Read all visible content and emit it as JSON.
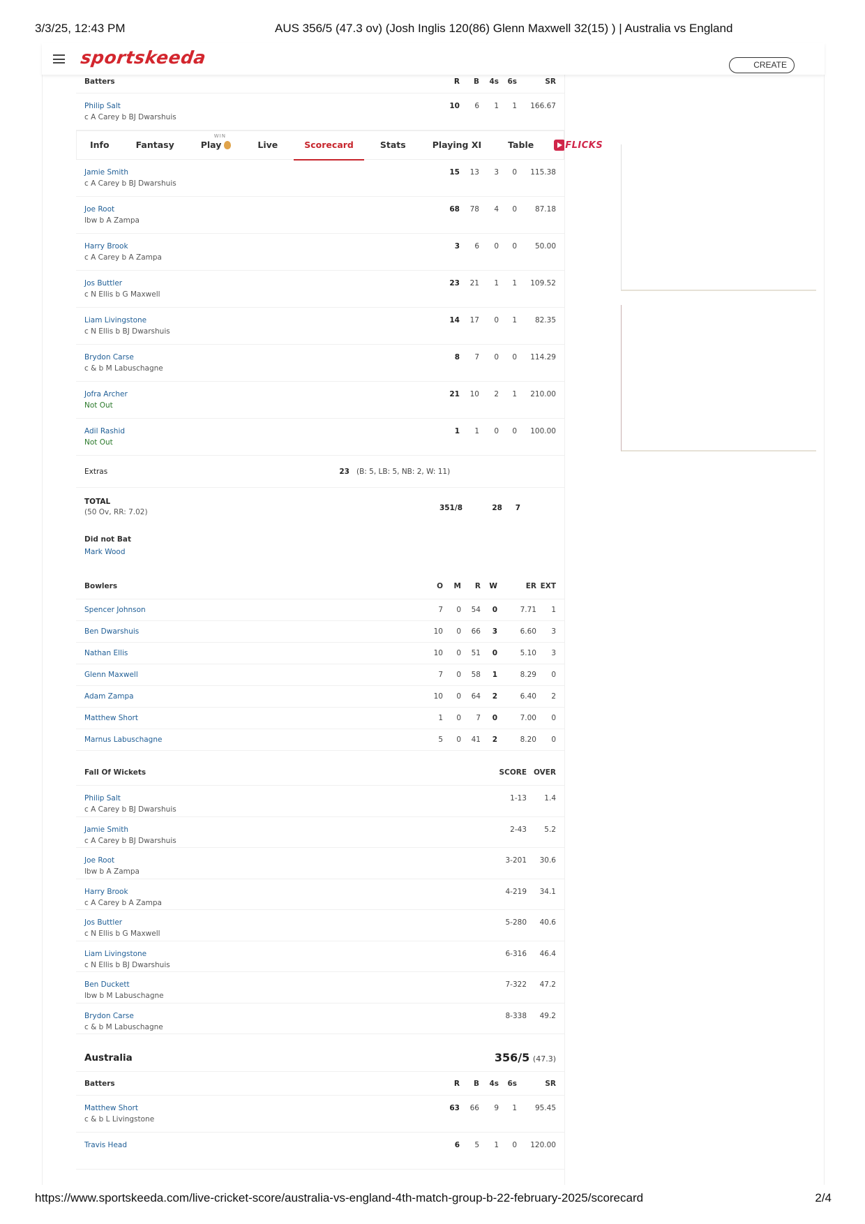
{
  "print_header": {
    "date": "3/3/25, 12:43 PM",
    "title": "AUS 356/5 (47.3 ov) (Josh Inglis 120(86) Glenn Maxwell 32(15) ) | Australia vs England"
  },
  "print_footer": {
    "url": "https://www.sportskeeda.com/live-cricket-score/australia-vs-england-4th-match-group-b-22-february-2025/scorecard",
    "page": "2/4"
  },
  "topbar": {
    "logo": "sportskeeda",
    "create_label": "CREATE",
    "brand_color": "#d3262e"
  },
  "tabs": {
    "items": [
      {
        "label": "Info"
      },
      {
        "label": "Fantasy"
      },
      {
        "label": "Play",
        "badge": "WIN"
      },
      {
        "label": "Live"
      },
      {
        "label": "Scorecard",
        "active": true
      },
      {
        "label": "Stats"
      },
      {
        "label": "Playing XI"
      },
      {
        "label": "Table"
      }
    ],
    "flicks_label": "FLICKS"
  },
  "england_innings": {
    "batting_header": {
      "title": "Batters",
      "r": "R",
      "b": "B",
      "fours": "4s",
      "sixes": "6s",
      "sr": "SR"
    },
    "batters": [
      {
        "name": "Philip Salt",
        "dismissal": "c A Carey b BJ Dwarshuis",
        "r": "10",
        "b": "6",
        "fours": "1",
        "sixes": "1",
        "sr": "166.67"
      },
      {
        "name": "Jamie Smith",
        "dismissal": "c A Carey b BJ Dwarshuis",
        "r": "15",
        "b": "13",
        "fours": "3",
        "sixes": "0",
        "sr": "115.38"
      },
      {
        "name": "Joe Root",
        "dismissal": "lbw b A Zampa",
        "r": "68",
        "b": "78",
        "fours": "4",
        "sixes": "0",
        "sr": "87.18"
      },
      {
        "name": "Harry Brook",
        "dismissal": "c A Carey b A Zampa",
        "r": "3",
        "b": "6",
        "fours": "0",
        "sixes": "0",
        "sr": "50.00"
      },
      {
        "name": "Jos Buttler",
        "dismissal": "c N Ellis b G Maxwell",
        "r": "23",
        "b": "21",
        "fours": "1",
        "sixes": "1",
        "sr": "109.52"
      },
      {
        "name": "Liam Livingstone",
        "dismissal": "c N Ellis b BJ Dwarshuis",
        "r": "14",
        "b": "17",
        "fours": "0",
        "sixes": "1",
        "sr": "82.35"
      },
      {
        "name": "Brydon Carse",
        "dismissal": "c & b M Labuschagne",
        "r": "8",
        "b": "7",
        "fours": "0",
        "sixes": "0",
        "sr": "114.29"
      },
      {
        "name": "Jofra Archer",
        "dismissal": "Not Out",
        "not_out": true,
        "r": "21",
        "b": "10",
        "fours": "2",
        "sixes": "1",
        "sr": "210.00"
      },
      {
        "name": "Adil Rashid",
        "dismissal": "Not Out",
        "not_out": true,
        "r": "1",
        "b": "1",
        "fours": "0",
        "sixes": "0",
        "sr": "100.00"
      }
    ],
    "extras": {
      "label": "Extras",
      "value": "23",
      "detail": "(B: 5, LB: 5, NB: 2, W: 11)"
    },
    "total": {
      "label": "TOTAL",
      "detail": "(50 Ov, RR: 7.02)",
      "score": "351/8",
      "fours": "28",
      "sixes": "7"
    },
    "did_not_bat": {
      "label": "Did not Bat",
      "players": [
        "Mark Wood"
      ]
    },
    "bowling_header": {
      "title": "Bowlers",
      "o": "O",
      "m": "M",
      "r": "R",
      "w": "W",
      "er": "ER",
      "ext": "EXT"
    },
    "bowlers": [
      {
        "name": "Spencer Johnson",
        "o": "7",
        "m": "0",
        "r": "54",
        "w": "0",
        "er": "7.71",
        "ext": "1"
      },
      {
        "name": "Ben Dwarshuis",
        "o": "10",
        "m": "0",
        "r": "66",
        "w": "3",
        "er": "6.60",
        "ext": "3"
      },
      {
        "name": "Nathan Ellis",
        "o": "10",
        "m": "0",
        "r": "51",
        "w": "0",
        "er": "5.10",
        "ext": "3"
      },
      {
        "name": "Glenn Maxwell",
        "o": "7",
        "m": "0",
        "r": "58",
        "w": "1",
        "er": "8.29",
        "ext": "0"
      },
      {
        "name": "Adam Zampa",
        "o": "10",
        "m": "0",
        "r": "64",
        "w": "2",
        "er": "6.40",
        "ext": "2"
      },
      {
        "name": "Matthew Short",
        "o": "1",
        "m": "0",
        "r": "7",
        "w": "0",
        "er": "7.00",
        "ext": "0"
      },
      {
        "name": "Marnus Labuschagne",
        "o": "5",
        "m": "0",
        "r": "41",
        "w": "2",
        "er": "8.20",
        "ext": "0"
      }
    ],
    "fow_header": {
      "title": "Fall Of Wickets",
      "score": "SCORE",
      "over": "OVER"
    },
    "fall_of_wickets": [
      {
        "name": "Philip Salt",
        "dismissal": "c A Carey b BJ Dwarshuis",
        "score": "1-13",
        "over": "1.4"
      },
      {
        "name": "Jamie Smith",
        "dismissal": "c A Carey b BJ Dwarshuis",
        "score": "2-43",
        "over": "5.2"
      },
      {
        "name": "Joe Root",
        "dismissal": "lbw b A Zampa",
        "score": "3-201",
        "over": "30.6"
      },
      {
        "name": "Harry Brook",
        "dismissal": "c A Carey b A Zampa",
        "score": "4-219",
        "over": "34.1"
      },
      {
        "name": "Jos Buttler",
        "dismissal": "c N Ellis b G Maxwell",
        "score": "5-280",
        "over": "40.6"
      },
      {
        "name": "Liam Livingstone",
        "dismissal": "c N Ellis b BJ Dwarshuis",
        "score": "6-316",
        "over": "46.4"
      },
      {
        "name": "Ben Duckett",
        "dismissal": "lbw b M Labuschagne",
        "score": "7-322",
        "over": "47.2"
      },
      {
        "name": "Brydon Carse",
        "dismissal": "c & b M Labuschagne",
        "score": "8-338",
        "over": "49.2"
      }
    ]
  },
  "australia_innings": {
    "team": "Australia",
    "score": "356/5",
    "overs": "(47.3)",
    "batting_header": {
      "title": "Batters",
      "r": "R",
      "b": "B",
      "fours": "4s",
      "sixes": "6s",
      "sr": "SR"
    },
    "batters": [
      {
        "name": "Matthew Short",
        "dismissal": "c & b L Livingstone",
        "r": "63",
        "b": "66",
        "fours": "9",
        "sixes": "1",
        "sr": "95.45"
      },
      {
        "name": "Travis Head",
        "dismissal": "",
        "r": "6",
        "b": "5",
        "fours": "1",
        "sixes": "0",
        "sr": "120.00"
      }
    ]
  }
}
